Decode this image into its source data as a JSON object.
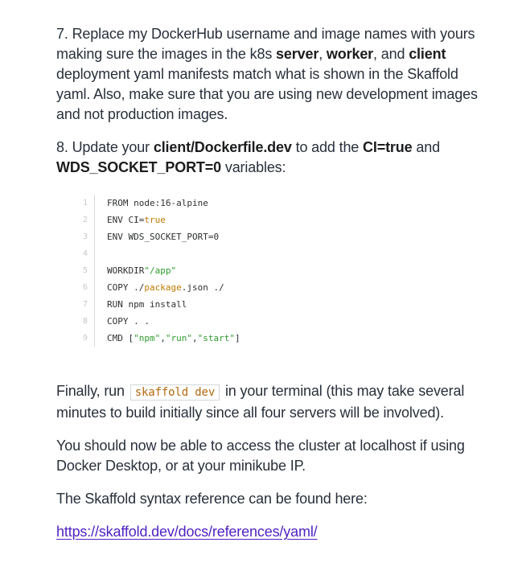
{
  "step7": {
    "part1": "7. Replace my DockerHub username and image names with yours making sure the images in the k8s ",
    "bold1": "server",
    "sep1": ", ",
    "bold2": "worker",
    "sep2": ", and ",
    "bold3": "client",
    "part2": " deployment yaml manifests match what is shown in the Skaffold yaml. Also, make sure that you are using new development images and not production images."
  },
  "step8": {
    "part1": "8. Update your ",
    "bold1": "client/Dockerfile.dev",
    "part2": " to add the ",
    "bold2": "CI=true",
    "part3": " and ",
    "bold3": "WDS_SOCKET_PORT=0",
    "part4": " variables:"
  },
  "code": {
    "lines": [
      {
        "num": "1",
        "a": "FROM node:16-alpine"
      },
      {
        "num": "2",
        "a": "ENV CI=",
        "kw": "true"
      },
      {
        "num": "3",
        "a": "ENV WDS_SOCKET_PORT=0"
      },
      {
        "num": "4",
        "a": ""
      },
      {
        "num": "5",
        "a": "WORKDIR ",
        "str": "\"/app\""
      },
      {
        "num": "6",
        "a": "COPY ./",
        "kw": "package",
        "b": ".json ./"
      },
      {
        "num": "7",
        "a": "RUN npm install"
      },
      {
        "num": "8",
        "a": "COPY . ."
      },
      {
        "num": "9",
        "a": "CMD [",
        "s1": "\"npm\"",
        "c1": ", ",
        "s2": "\"run\"",
        "c2": ", ",
        "s3": "\"start\"",
        "end": "]"
      }
    ]
  },
  "finally": {
    "part1": "Finally, run ",
    "code": "skaffold dev",
    "part2": " in your terminal (this may take several minutes to build initially since all four servers will be involved)."
  },
  "access_text": "You should now be able to access the cluster at localhost if using Docker Desktop, or at your minikube IP.",
  "reference_text": "The Skaffold syntax reference can be found here:",
  "reference_link": "https://skaffold.dev/docs/references/yaml/"
}
